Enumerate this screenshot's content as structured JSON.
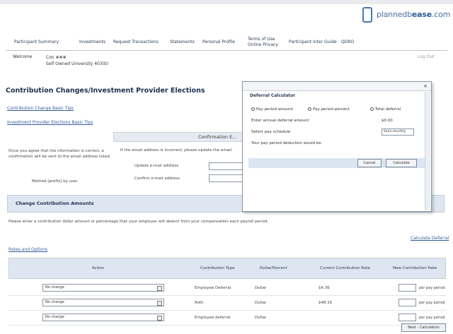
{
  "brand": {
    "name_prefix": "plannedb",
    "name_bold": "ease",
    "name_suffix": ".com"
  },
  "nav": {
    "items": [
      {
        "label": "Participant Summary"
      },
      {
        "label": "Investments"
      },
      {
        "label": "Request Transactions"
      },
      {
        "label": "Statements"
      },
      {
        "label": "Personal Profile"
      },
      {
        "label": "Terms of Use Online Privacy"
      },
      {
        "label": "Participant Inter Guide"
      },
      {
        "label": "QDRO"
      }
    ]
  },
  "header": {
    "welcome_label": "Welcome",
    "user_name": "Con ###",
    "plan_name": "Self Owned University 403(b)",
    "right_text": "Log Out"
  },
  "page": {
    "title": "Contribution Changes/Investment Provider Elections",
    "link1": "Contribution Change Basic Tips",
    "link2": "Investment Provider Elections Basic Tips",
    "confirmation_header": "Confirmation E...",
    "conf_text_left": "Once you agree that the information is correct, a confirmation will be sent to the email address listed.",
    "conf_text_right": "If the email address is incorrect, please update the email.",
    "email_label1": "Update e-mail address",
    "email_label2": "Confirm e-mail address",
    "method_label": "Method [prefix] by user",
    "change_section_title": "Change Contribution Amounts",
    "instructions": "Please enter a contribution dollar amount or percentage that your employer will deduct from your compensation each payroll period.",
    "calc_link": "Calculate Deferral",
    "rates_link": "Rates and Options"
  },
  "table": {
    "headers": [
      "Action",
      "Contribution Type",
      "Dollar/Percent",
      "Current Contribution Rate",
      "New Contribution Rate"
    ],
    "rows": [
      {
        "action": "No change",
        "type": "Employee Deferral",
        "unit": "Dollar",
        "current": "$4.36",
        "per": "per pay period"
      },
      {
        "action": "No change",
        "type": "Roth",
        "unit": "Dollar",
        "current": "$48.16",
        "per": "per pay period"
      },
      {
        "action": "No change",
        "type": "Employee deferral",
        "unit": "Dollar",
        "current": "",
        "per": "per pay period"
      }
    ],
    "bottom_button": "Next - Calculation"
  },
  "modal": {
    "title": "Deferral Calculator",
    "radio_options": [
      "Pay period amount",
      "Pay period percent",
      "Total deferral"
    ],
    "lbl_total": "Enter annual deferral amount",
    "val_total": "$0.00",
    "lbl_schedule": "Select pay schedule",
    "schedule_value": "Semi-monthly",
    "lbl_result": "Your pay period deduction would be",
    "btn_cancel": "Cancel",
    "btn_calculate": "Calculate",
    "close_symbol": "×"
  }
}
